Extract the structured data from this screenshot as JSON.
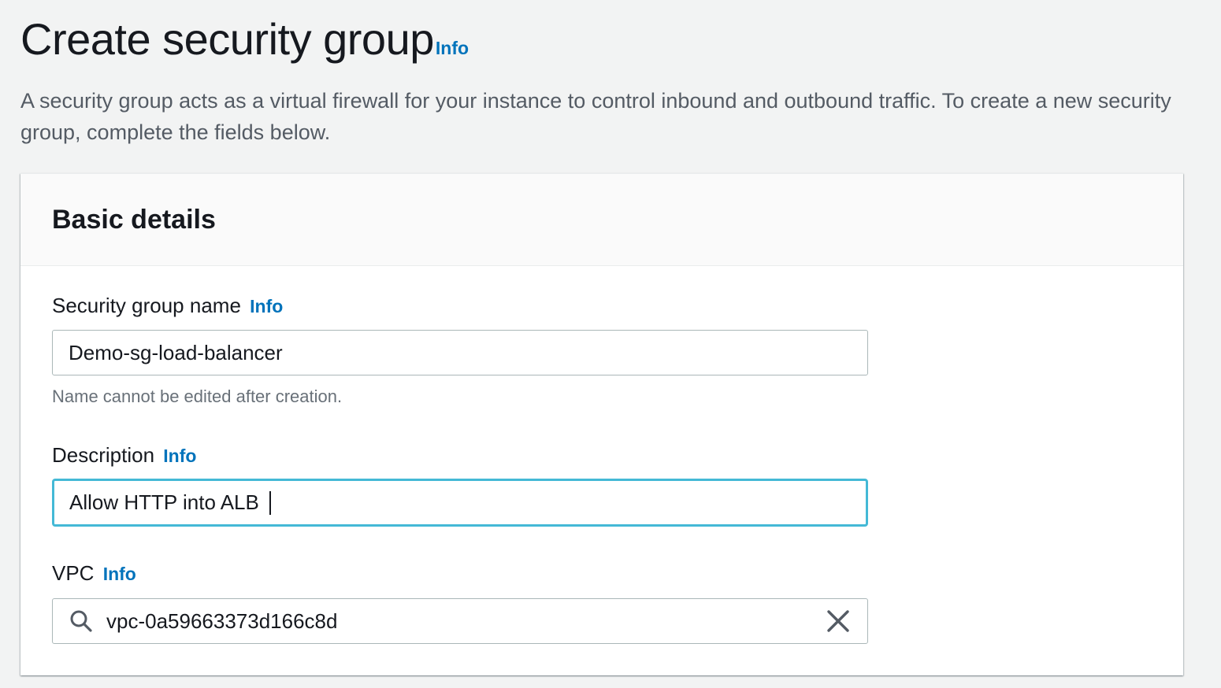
{
  "header": {
    "title": "Create security group",
    "info_label": "Info",
    "description": "A security group acts as a virtual firewall for your instance to control inbound and outbound traffic. To create a new security group, complete the fields below."
  },
  "basic_details": {
    "title": "Basic details",
    "name_field": {
      "label": "Security group name",
      "info_label": "Info",
      "value": "Demo-sg-load-balancer",
      "constraint": "Name cannot be edited after creation."
    },
    "description_field": {
      "label": "Description",
      "info_label": "Info",
      "value": "Allow HTTP into ALB "
    },
    "vpc_field": {
      "label": "VPC",
      "info_label": "Info",
      "value": "vpc-0a59663373d166c8d",
      "search_icon": "search-icon",
      "clear_icon": "close-icon"
    }
  },
  "colors": {
    "page_background": "#f2f3f3",
    "link": "#0073bb",
    "focus_border": "#44b9d6",
    "input_border": "#aab7b8",
    "text_primary": "#16191f",
    "text_secondary": "#687078"
  }
}
